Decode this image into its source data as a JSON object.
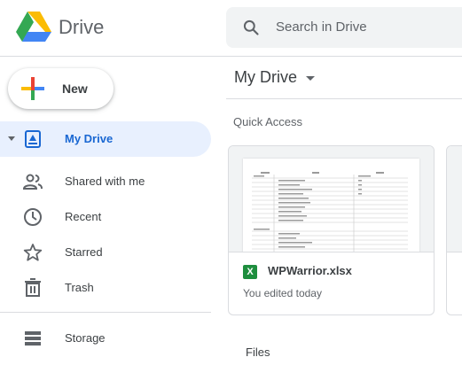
{
  "app": {
    "name": "Drive"
  },
  "search": {
    "placeholder": "Search in Drive"
  },
  "sidebar": {
    "new_label": "New",
    "items": [
      {
        "label": "My Drive",
        "icon": "my-drive-icon",
        "active": true
      },
      {
        "label": "Shared with me",
        "icon": "people-icon"
      },
      {
        "label": "Recent",
        "icon": "clock-icon"
      },
      {
        "label": "Starred",
        "icon": "star-icon"
      },
      {
        "label": "Trash",
        "icon": "trash-icon"
      }
    ],
    "storage_label": "Storage"
  },
  "main": {
    "title": "My Drive",
    "quick_access_label": "Quick Access",
    "files_label": "Files",
    "quick_access": [
      {
        "name": "WPWarrior.xlsx",
        "subtitle": "You edited today",
        "type_badge": "X",
        "type_color": "#1e8e3e"
      }
    ]
  },
  "colors": {
    "accent": "#1967d2",
    "active_bg": "#e8f0fe"
  }
}
